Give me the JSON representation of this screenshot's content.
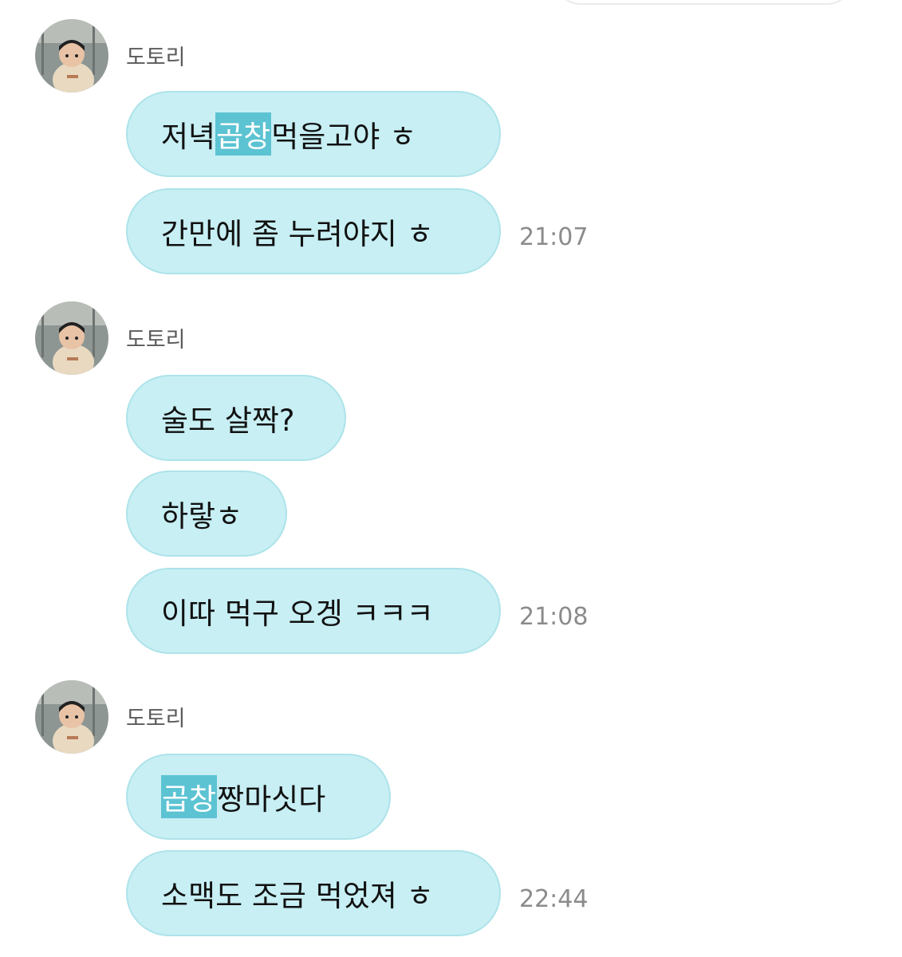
{
  "messages": [
    {
      "sender": "도토리",
      "bubbles": [
        {
          "pre": "저녁 ",
          "hl": "곱창",
          "post": " 먹을고야 ㅎ"
        },
        {
          "pre": "",
          "hl": "",
          "post": "간만에 좀 누려야지 ㅎ"
        }
      ],
      "time": "21:07"
    },
    {
      "sender": "도토리",
      "bubbles": [
        {
          "pre": "",
          "hl": "",
          "post": "술도 살짝?"
        },
        {
          "pre": "",
          "hl": "",
          "post": "하랗ㅎ"
        },
        {
          "pre": "",
          "hl": "",
          "post": "이따 먹구 오겡 ㅋㅋㅋ"
        }
      ],
      "time": "21:08"
    },
    {
      "sender": "도토리",
      "bubbles": [
        {
          "pre": "",
          "hl": "곱창",
          "post": " 짱마싯다"
        },
        {
          "pre": "",
          "hl": "",
          "post": "소맥도 조금 먹었져 ㅎ"
        }
      ],
      "time": "22:44"
    }
  ],
  "colors": {
    "bubble": "#c7eff4",
    "bubble_border": "#aee3ea",
    "highlight": "#5cc3d2"
  },
  "avatar_icon": "child-photo-avatar"
}
